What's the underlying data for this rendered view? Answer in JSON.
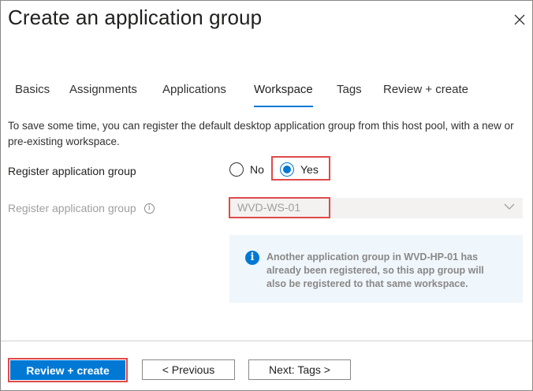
{
  "dialog": {
    "title": "Create an application group",
    "close_icon": "close-icon"
  },
  "tabs": [
    {
      "label": "Basics",
      "active": false
    },
    {
      "label": "Assignments",
      "active": false
    },
    {
      "label": "Applications",
      "active": false
    },
    {
      "label": "Workspace",
      "active": true
    },
    {
      "label": "Tags",
      "active": false
    },
    {
      "label": "Review + create",
      "active": false
    }
  ],
  "description": "To save some time, you can register the default desktop application group from this host pool, with a new or pre-existing workspace.",
  "register_radio": {
    "label": "Register application group",
    "options": [
      "No",
      "Yes"
    ],
    "selected": "Yes"
  },
  "workspace_select": {
    "label": "Register application group",
    "info_icon": "info-icon",
    "value": "WVD-WS-01",
    "disabled": true
  },
  "info_message": "Another application group in WVD-HP-01 has already been registered, so this app group will also be registered to that same workspace.",
  "footer": {
    "review_create": "Review + create",
    "previous": "< Previous",
    "next": "Next: Tags >"
  },
  "colors": {
    "accent": "#0078d4",
    "highlight": "#e04a4a"
  }
}
